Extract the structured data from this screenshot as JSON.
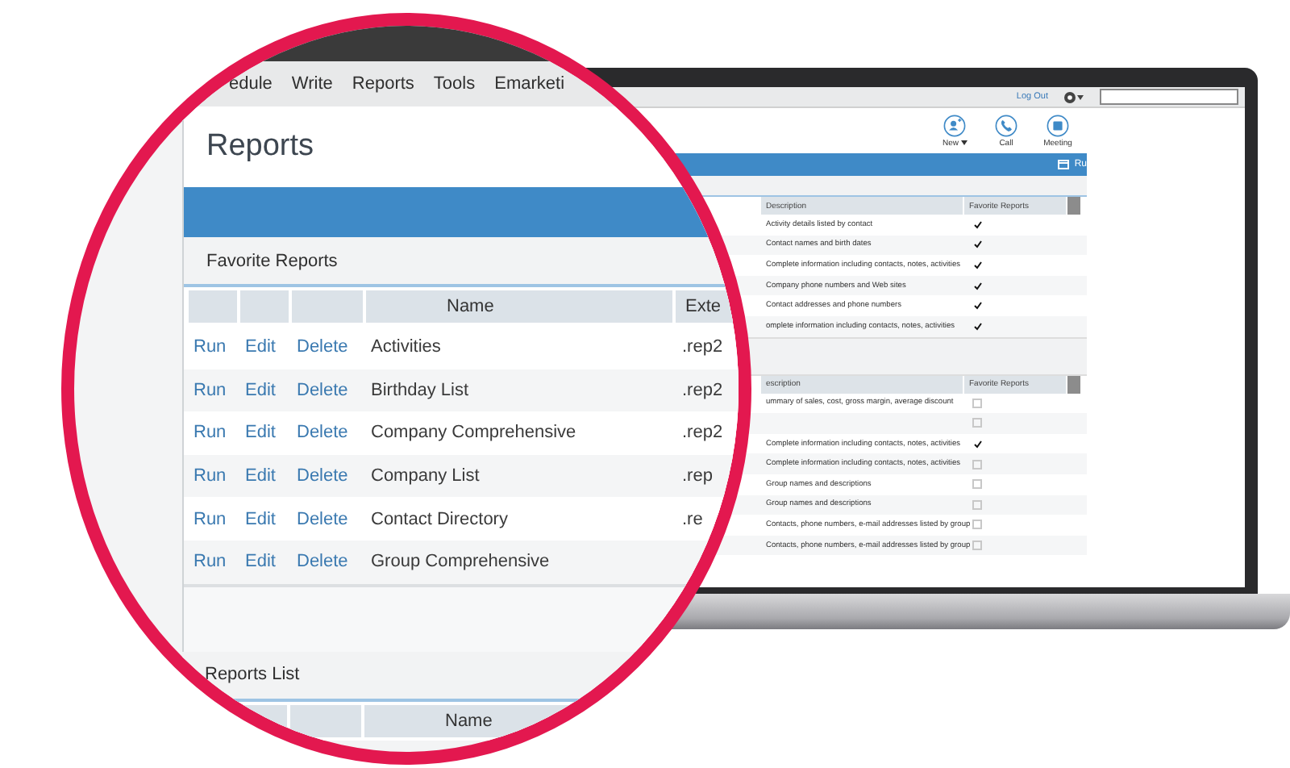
{
  "nav_menu": [
    {
      "label": "edule"
    },
    {
      "label": "Write"
    },
    {
      "label": "Reports"
    },
    {
      "label": "Tools"
    },
    {
      "label": "Emarketi"
    }
  ],
  "page_title": "Reports",
  "favorite_reports": {
    "heading": "Favorite Reports",
    "columns": [
      "Name",
      "Exte"
    ],
    "rows": [
      {
        "actions": [
          "Run",
          "Edit",
          "Delete"
        ],
        "name": "Activities",
        "ext": ".rep2"
      },
      {
        "actions": [
          "Run",
          "Edit",
          "Delete"
        ],
        "name": "Birthday List",
        "ext": ".rep2"
      },
      {
        "actions": [
          "Run",
          "Edit",
          "Delete"
        ],
        "name": "Company Comprehensive",
        "ext": ".rep2"
      },
      {
        "actions": [
          "Run",
          "Edit",
          "Delete"
        ],
        "name": "Company List",
        "ext": ".rep"
      },
      {
        "actions": [
          "Run",
          "Edit",
          "Delete"
        ],
        "name": "Contact Directory",
        "ext": ".re"
      },
      {
        "actions": [
          "Run",
          "Edit",
          "Delete"
        ],
        "name": "Group Comprehensive"
      }
    ]
  },
  "reports_list": {
    "heading": "Reports List",
    "columns": [
      "Name"
    ]
  },
  "screen": {
    "logout": "Log Out",
    "toolbar": [
      {
        "kind": "new",
        "label": "New"
      },
      {
        "kind": "call",
        "label": "Call"
      },
      {
        "kind": "meeting",
        "label": "Meeting"
      }
    ],
    "run_button": "Ru",
    "favorites_table": {
      "columns": [
        "Description",
        "Favorite Reports"
      ],
      "rows": [
        {
          "description": "Activity details listed by contact",
          "favorite": true
        },
        {
          "description": "Contact names and birth dates",
          "favorite": true
        },
        {
          "description": "Complete information including contacts, notes, activities",
          "favorite": true
        },
        {
          "description": "Company phone numbers and Web sites",
          "favorite": true
        },
        {
          "description": "Contact addresses and phone numbers",
          "favorite": true
        },
        {
          "description": "omplete information including contacts, notes, activities",
          "favorite": true
        }
      ]
    },
    "reports_table": {
      "columns": [
        "escription",
        "Favorite Reports"
      ],
      "rows": [
        {
          "description": "ummary of sales, cost, gross margin, average discount",
          "favorite": false
        },
        {
          "favorite": false
        },
        {
          "description": "Complete information including contacts, notes, activities",
          "favorite": true
        },
        {
          "description": "Complete information including contacts, notes, activities",
          "favorite": false
        },
        {
          "description": "Group names and descriptions",
          "favorite": false
        },
        {
          "description": "Group names and descriptions",
          "favorite": false
        },
        {
          "description": "Contacts, phone numbers, e-mail addresses listed by group",
          "favorite": false
        },
        {
          "description": "Contacts, phone numbers, e-mail addresses listed by group",
          "favorite": false
        }
      ]
    }
  }
}
